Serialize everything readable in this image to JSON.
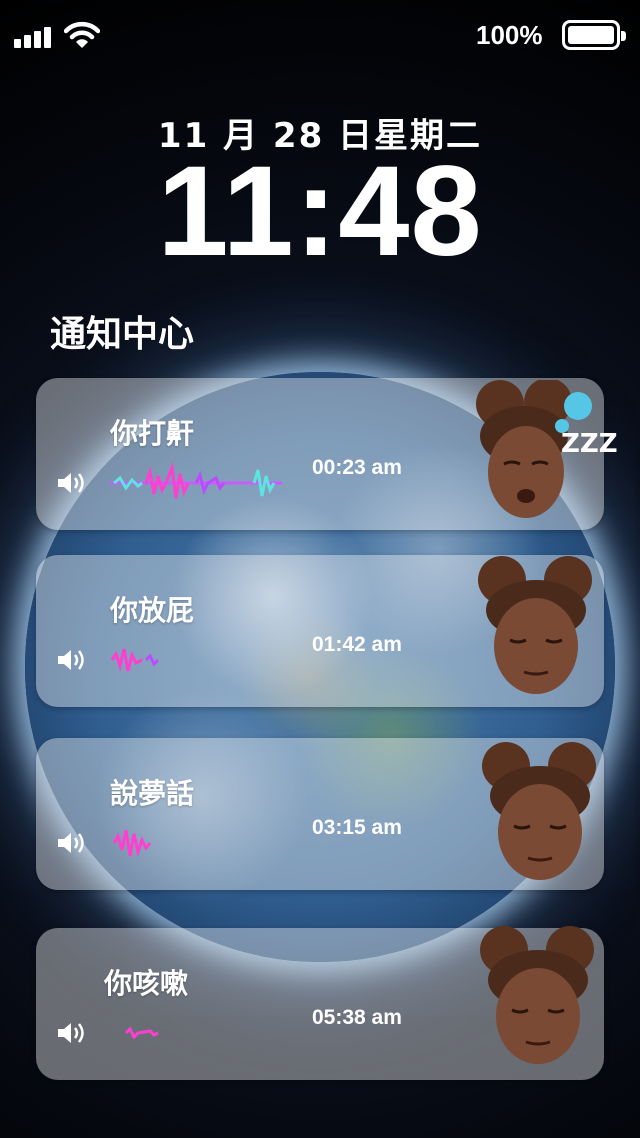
{
  "status": {
    "battery_percent_text": "100%",
    "battery_level": 1.0,
    "signal_bars": 4
  },
  "lock": {
    "date": "11 月 28 日星期二",
    "time": "11:48",
    "notification_center_title": "通知中心"
  },
  "colors": {
    "wave_start": "#ff3fd0",
    "wave_mid": "#b84dff",
    "wave_end": "#ffd23f",
    "wave_cyan": "#5fe3e0"
  },
  "cards": [
    {
      "label": "你打鼾",
      "time": "00:23 am",
      "avatar_expression": "sleeping"
    },
    {
      "label": "你放屁",
      "time": "01:42 am",
      "avatar_expression": "squint"
    },
    {
      "label": "說夢話",
      "time": "03:15 am",
      "avatar_expression": "squint"
    },
    {
      "label": "你咳嗽",
      "time": "05:38 am",
      "avatar_expression": "squint"
    }
  ],
  "zzz_text": "ZZZ"
}
